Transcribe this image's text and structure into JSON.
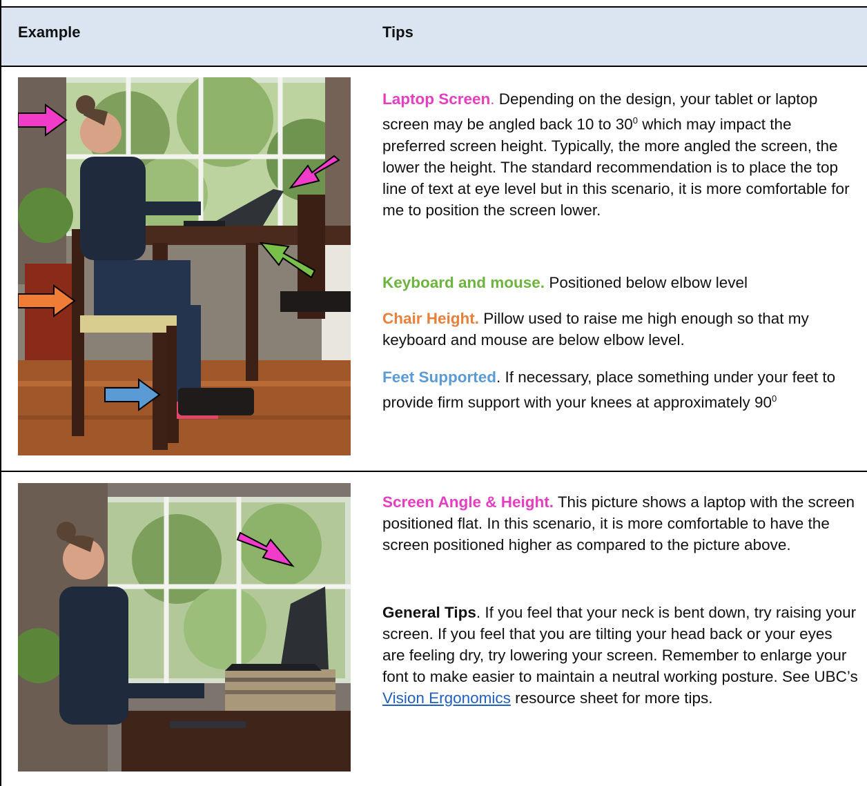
{
  "header": {
    "col_example": "Example",
    "col_tips": "Tips"
  },
  "row1": {
    "laptop_title": "Laptop Screen",
    "laptop_dot": ".",
    "laptop_text_a": " Depending on the design, your tablet or laptop screen may be angled back 10 to 30",
    "laptop_sup": "0",
    "laptop_text_b": " which may impact the preferred screen height. Typically, the more angled the screen, the lower the height.  The standard recommendation is to place the top line of text at eye level but in this scenario, it is more comfortable for me to position the screen lower.",
    "keyboard_title": "Keyboard and mouse.",
    "keyboard_text": " Positioned below elbow level",
    "chair_title": "Chair Height.",
    "chair_text": " Pillow used to raise me high enough so that my keyboard and mouse are below elbow level.",
    "feet_title": "Feet Supported",
    "feet_text": ". If necessary, place something under your feet to provide firm support with your knees at approximately 90",
    "feet_sup": "0"
  },
  "row2": {
    "screen_title": "Screen Angle & Height.",
    "screen_text": " This picture shows a laptop with the screen positioned flat. In this scenario, it is more comfortable to have the screen positioned higher as compared to the picture above.",
    "general_title": "General Tips",
    "general_text": ". If you feel that your neck is bent down, try raising your screen. If you feel that you are tilting your head back or your eyes are feeling dry, try lowering your screen. Remember to enlarge your font to make easier to maintain a neutral working posture. See UBC’s ",
    "link_text": "Vision Ergonomics",
    "general_tail": " resource sheet for more tips."
  },
  "colors": {
    "header_bg": "#dbe5f1",
    "magenta": "#e53ec1",
    "green": "#6db33f",
    "orange": "#e8803a",
    "blue": "#5b9bd5",
    "link": "#1f5fbf"
  },
  "icons": [
    "magenta-arrow-icon",
    "green-arrow-icon",
    "orange-arrow-icon",
    "blue-arrow-icon"
  ]
}
